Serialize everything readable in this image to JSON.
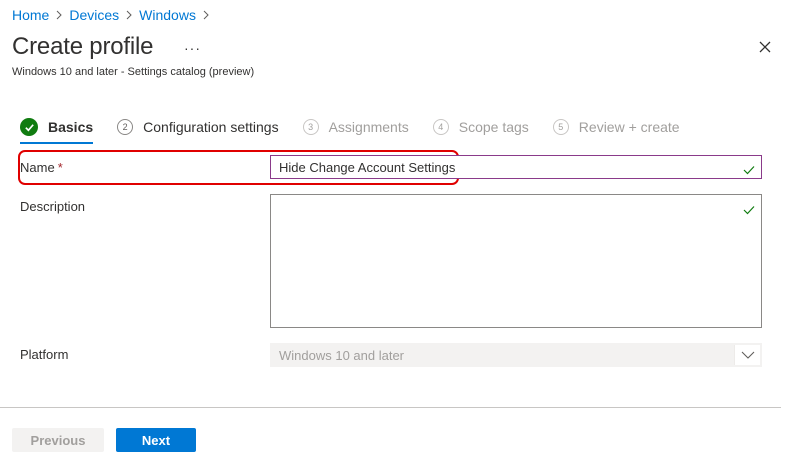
{
  "breadcrumb": [
    "Home",
    "Devices",
    "Windows"
  ],
  "header": {
    "title": "Create profile",
    "more_label": "···",
    "subtitle": "Windows 10 and later - Settings catalog (preview)"
  },
  "steps": [
    {
      "number": "",
      "label": "Basics",
      "state": "done"
    },
    {
      "number": "2",
      "label": "Configuration settings",
      "state": "upcoming"
    },
    {
      "number": "3",
      "label": "Assignments",
      "state": "disabled"
    },
    {
      "number": "4",
      "label": "Scope tags",
      "state": "disabled"
    },
    {
      "number": "5",
      "label": "Review + create",
      "state": "disabled"
    }
  ],
  "form": {
    "name_label": "Name",
    "required_mark": "*",
    "name_value": "Hide Change Account Settings",
    "description_label": "Description",
    "description_value": "",
    "platform_label": "Platform",
    "platform_value": "Windows 10 and later"
  },
  "footer": {
    "previous_label": "Previous",
    "next_label": "Next"
  },
  "colors": {
    "accent": "#0078d4",
    "success": "#107c10",
    "highlight": "#e00000"
  }
}
